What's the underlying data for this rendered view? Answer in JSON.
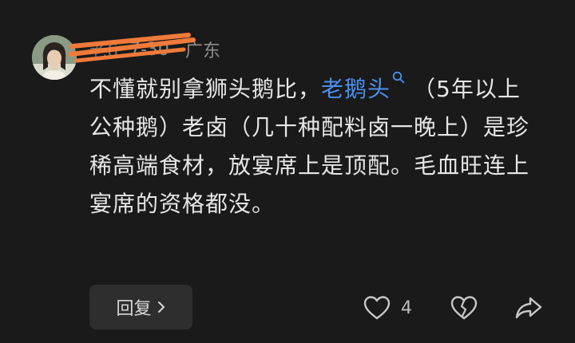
{
  "comment": {
    "username": "老6",
    "date": "7-30",
    "location": "广东",
    "text_before": "不懂就别拿狮头鹅比，",
    "link_text": "老鹅头",
    "text_after": "（5年以上公种鹅）老卤（几十种配料卤一晚上）是珍稀高端食材，放宴席上是顶配。毛血旺连上宴席的资格都没。"
  },
  "actions": {
    "reply_label": "回复",
    "like_count": "4"
  },
  "icons": {
    "avatar": "anime-girl-avatar",
    "link_search": "search-icon",
    "reply_chevron": "chevron-right-icon",
    "like": "heart-icon",
    "dislike": "broken-heart-icon",
    "share": "share-arrow-icon"
  },
  "colors": {
    "background": "#1a1a1a",
    "link": "#4a90f0",
    "text": "#e6e6e6",
    "meta": "#8d8d8d",
    "scribble": "#f07a3a"
  }
}
